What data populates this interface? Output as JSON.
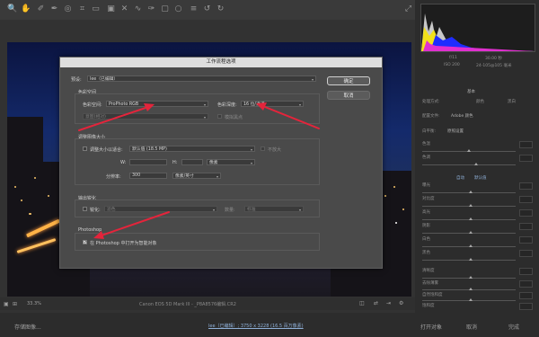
{
  "dialog": {
    "title": "工作流程选项",
    "preset_label": "预设:",
    "preset_value": "lee（已编辑）",
    "ok_label": "确定",
    "cancel_label": "取消",
    "color_space": {
      "section": "色彩空间",
      "space_label": "色彩空间:",
      "space_value": "ProPhoto RGB",
      "depth_label": "色彩深度:",
      "depth_value": "16 位/通道",
      "intent_value": "意图(相对)",
      "blackpoint_label": "模拟黑点"
    },
    "resize": {
      "section": "调整图像大小",
      "fit_label": "调整大小以适合:",
      "fit_value": "默认值 (18.5 MP)",
      "enlarge_label": "不放大",
      "w_label": "W:",
      "h_label": "H:",
      "units_value": "像素",
      "res_label": "分辨率:",
      "res_value": "300",
      "res_units": "像素/英寸"
    },
    "sharpen": {
      "section": "输出锐化",
      "sharpen_label": "锐化:",
      "sharpen_for": "滤色",
      "amount_label": "数量:",
      "amount_value": "标准"
    },
    "photoshop": {
      "section": "Photoshop",
      "smart_object_label": "在 Photoshop 中打开为智能对象",
      "smart_object_checked": true
    }
  },
  "status": {
    "zoom": "33.3%",
    "camera": "Canon EOS 5D Mark III - _P8A8576编辑.CR2"
  },
  "bottom": {
    "save_label": "存储图像...",
    "info": "lee（已编辑）; 3750 x 3228 (16.5 百万像素)",
    "open_label": "打开对象",
    "cancel_label": "取消",
    "done_label": "完成"
  },
  "right_panel": {
    "camera_info": [
      "f/11",
      "30.00 秒",
      "ISO 200",
      "24-105@105 毫米"
    ],
    "basic_title": "基本",
    "treatment_label": "处理方式:",
    "color_label": "颜色",
    "bw_label": "黑白",
    "profile_label": "配置文件:",
    "profile_value": "Adobe 颜色",
    "wb_label": "白平衡:",
    "wb_value": "原照设置",
    "sliders": [
      "色温",
      "色调",
      "曝光",
      "对比度",
      "高光",
      "阴影",
      "白色",
      "黑色",
      "清晰度",
      "去除薄雾",
      "自然饱和度",
      "饱和度"
    ],
    "auto_label": "自动",
    "default_label": "默认值"
  },
  "colors": {
    "annotation": "#e4243b",
    "dialog_bg": "#4a4a4a",
    "title_bar": "#dedede"
  }
}
